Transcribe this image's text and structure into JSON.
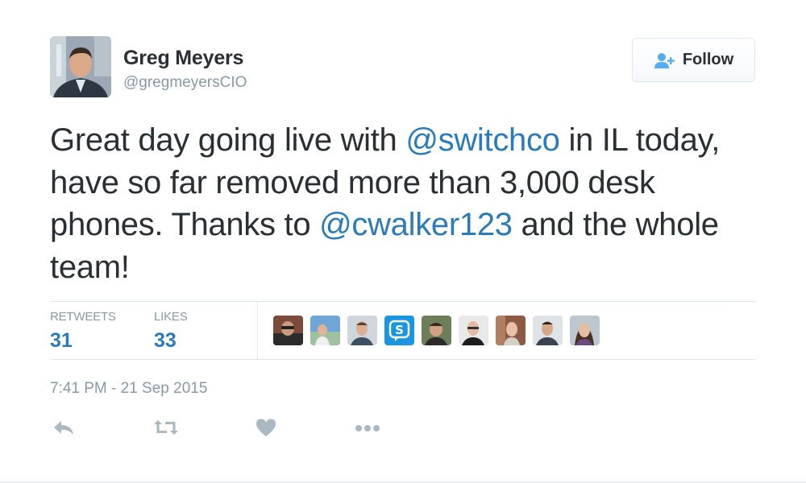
{
  "author": {
    "name": "Greg Meyers",
    "handle": "@gregmeyersCIO"
  },
  "follow_button": {
    "label": "Follow",
    "icon": "add-user-icon"
  },
  "tweet": {
    "segments": [
      {
        "text": "Great day going live with ",
        "type": "text"
      },
      {
        "text": "@switchco",
        "type": "mention"
      },
      {
        "text": " in IL today, have so far removed more than 3,000 desk phones.  Thanks to ",
        "type": "text"
      },
      {
        "text": "@cwalker123",
        "type": "mention"
      },
      {
        "text": " and the whole team!",
        "type": "text"
      }
    ]
  },
  "stats": {
    "retweets_label": "RETWEETS",
    "retweets_count": "31",
    "likes_label": "LIKES",
    "likes_count": "33"
  },
  "likers_count_shown": 9,
  "timestamp": "7:41 PM - 21 Sep 2015",
  "actions": [
    "reply-icon",
    "retweet-icon",
    "like-icon",
    "more-icon"
  ],
  "colors": {
    "mention": "#2b7bb9",
    "muted": "#8899a6",
    "text": "#292f33",
    "action_icon": "#aab8c2"
  }
}
